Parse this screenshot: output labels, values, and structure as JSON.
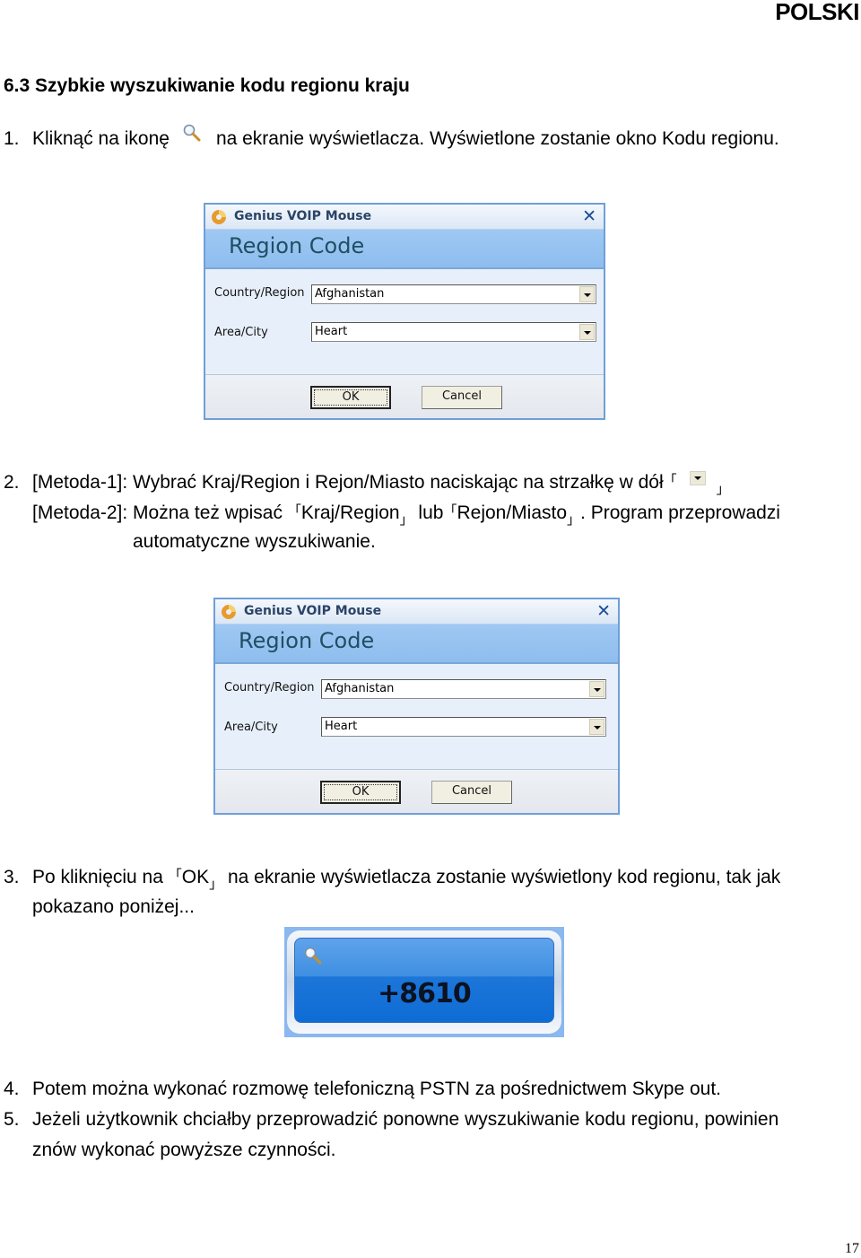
{
  "page": {
    "language_label": "POLSKI",
    "page_number": "17"
  },
  "section": {
    "heading": "6.3 Szybkie wyszukiwanie kodu regionu kraju"
  },
  "steps": {
    "step1": {
      "number": "1.",
      "before_icon": "Kliknąć na ikonę",
      "icon": "magnifier-icon",
      "after_icon": "na ekranie wyświetlacza. Wyświetlone zostanie okno Kodu regionu."
    },
    "step2": {
      "number": "2.",
      "line1": "[Metoda-1]: Wybrać Kraj/Region i Rejon/Miasto naciskając na strzałkę w dół",
      "line1_icon": "dropdown-arrow-icon",
      "line2_a": "[Metoda-2]: Można też wpisać",
      "line2_term1": "Kraj/Region",
      "line2_b": "lub",
      "line2_term2": "Rejon/Miasto",
      "line2_c": ". Program przeprowadzi",
      "line3": "automatyczne wyszukiwanie."
    },
    "step3": {
      "number": "3.",
      "line1_a": "Po kliknięciu na",
      "line1_term": "OK",
      "line1_b": "na ekranie wyświetlacza zostanie wyświetlony kod regionu, tak jak",
      "line2": "pokazano poniżej..."
    },
    "step4": {
      "number": "4.",
      "text": "Potem można wykonać rozmowę telefoniczną PSTN za pośrednictwem Skype out."
    },
    "step5": {
      "number": "5.",
      "line1": "Jeżeli użytkownik chciałby przeprowadzić ponowne wyszukiwanie kodu regionu, powinien",
      "line2": "znów wykonać powyższe czynności."
    },
    "bracket_open": "「",
    "bracket_close": "」"
  },
  "dialogs": [
    {
      "app_title": "Genius VOIP Mouse",
      "close_label": "✕",
      "header": "Region Code",
      "country_label": "Country/Region",
      "country_value": "Afghanistan",
      "city_label": "Area/City",
      "city_value": "Heart",
      "ok_label": "OK",
      "cancel_label": "Cancel"
    },
    {
      "app_title": "Genius VOIP Mouse",
      "close_label": "✕",
      "header": "Region Code",
      "country_label": "Country/Region",
      "country_value": "Afghanistan",
      "city_label": "Area/City",
      "city_value": "Heart",
      "ok_label": "OK",
      "cancel_label": "Cancel"
    }
  ],
  "display": {
    "code": "+8610",
    "icon": "magnifier-icon"
  },
  "colors": {
    "dialog_border": "#6f9fd7",
    "dialog_header": "#9fc8f3",
    "display_blue": "#1d76d9"
  }
}
